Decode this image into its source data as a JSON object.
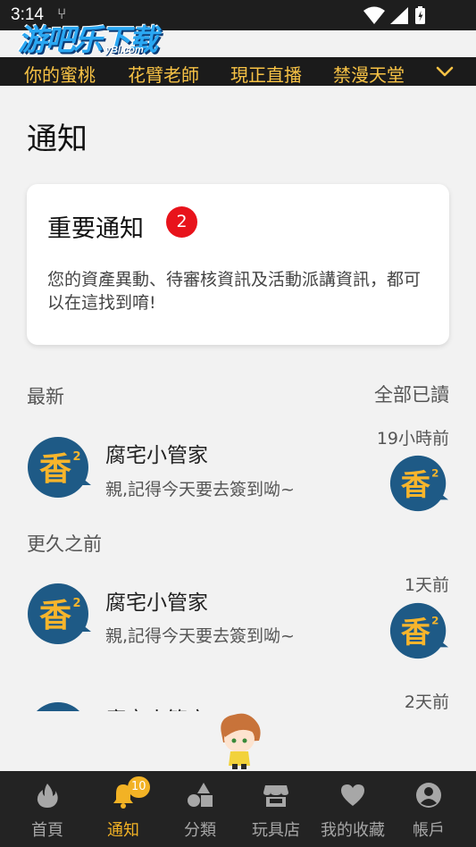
{
  "status_bar": {
    "time": "3:14"
  },
  "brand": {
    "main": "游吧乐下载",
    "sub": "yBl.com"
  },
  "top_nav": {
    "items": [
      "你的蜜桃",
      "花臂老師",
      "現正直播",
      "禁漫天堂"
    ],
    "more_icon": "chevron-down-icon"
  },
  "page": {
    "title": "通知"
  },
  "important_card": {
    "title": "重要通知",
    "badge": "2",
    "description": "您的資產異動、待審核資訊及活動派講資訊，都可以在這找到唷!"
  },
  "sections": {
    "latest": "最新",
    "older": "更久之前",
    "mark_all_read": "全部已讀"
  },
  "notifications": [
    {
      "name": "腐宅小管家",
      "message": "親,記得今天要去簽到呦~",
      "time": "19小時前"
    },
    {
      "name": "腐宅小管家",
      "message": "親,記得今天要去簽到呦~",
      "time": "1天前"
    },
    {
      "name": "腐宅小管家",
      "message": "",
      "time": "2天前"
    }
  ],
  "bottom_nav": {
    "items": [
      {
        "label": "首頁",
        "icon": "fire-icon"
      },
      {
        "label": "通知",
        "icon": "bell-icon",
        "badge": "10"
      },
      {
        "label": "分類",
        "icon": "shapes-icon"
      },
      {
        "label": "玩具店",
        "icon": "store-icon"
      },
      {
        "label": "我的收藏",
        "icon": "heart-icon"
      },
      {
        "label": "帳戶",
        "icon": "account-icon"
      }
    ],
    "active_index": 1
  },
  "colors": {
    "accent": "#f2b225",
    "badge_red": "#e8131b",
    "avatar_blue": "#1e5a86",
    "avatar_glyph": "#f7b52c"
  }
}
